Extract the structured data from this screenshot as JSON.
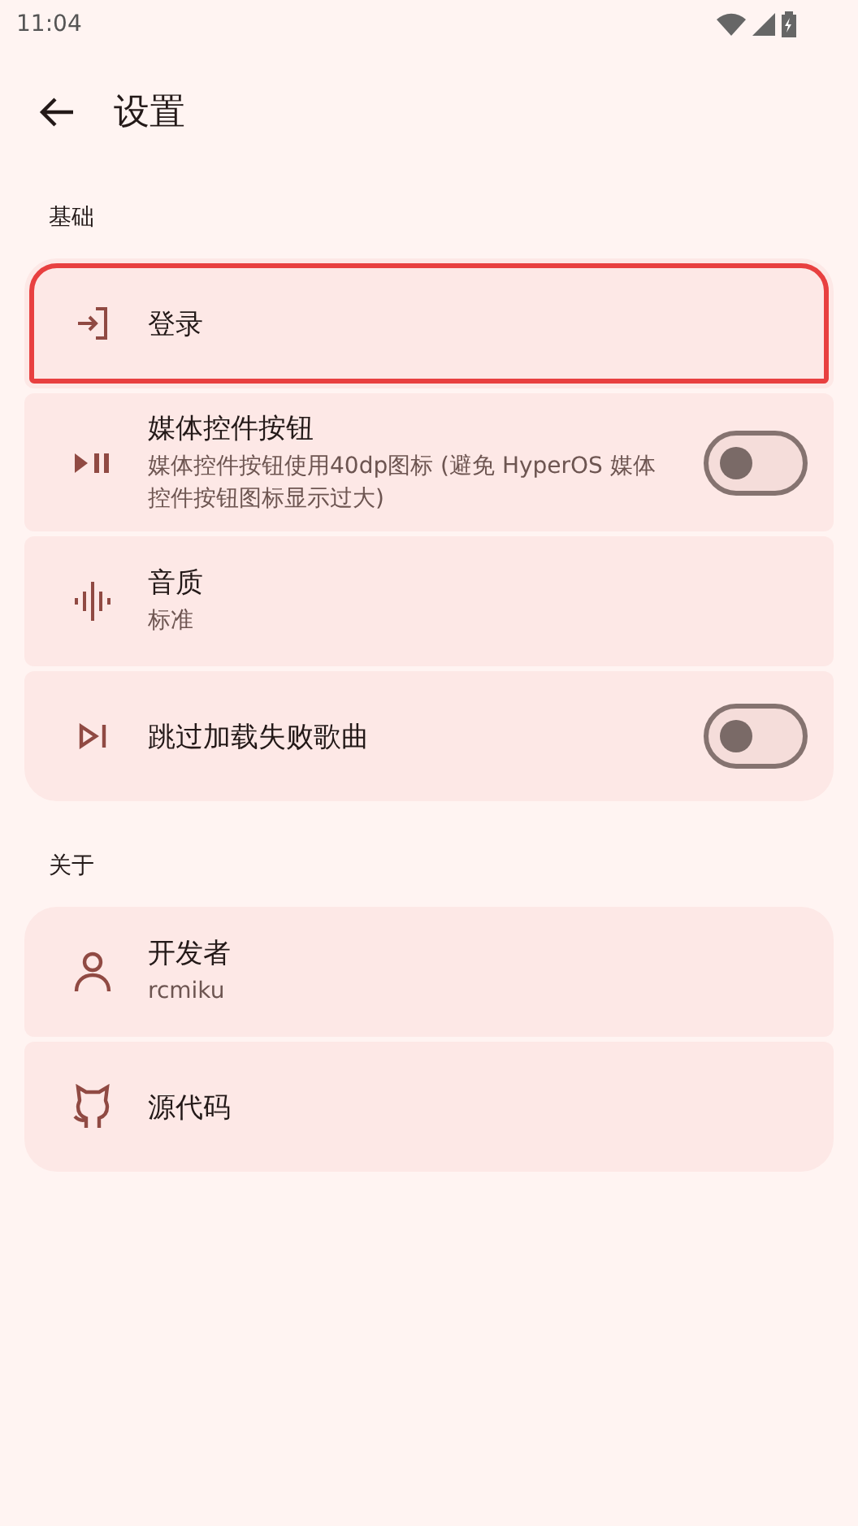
{
  "status_bar": {
    "time": "11:04"
  },
  "header": {
    "title": "设置"
  },
  "sections": [
    {
      "title": "基础",
      "items": [
        {
          "kind": "link",
          "title": "登录",
          "highlighted": true
        },
        {
          "kind": "switch",
          "title": "媒体控件按钮",
          "subtitle": "媒体控件按钮使用40dp图标 (避免 HyperOS 媒体控件按钮图标显示过大)",
          "on": false,
          "highlighted": false
        },
        {
          "kind": "link",
          "title": "音质",
          "subtitle": "标准",
          "highlighted": false
        },
        {
          "kind": "switch",
          "title": "跳过加载失败歌曲",
          "on": false,
          "highlighted": false
        }
      ]
    },
    {
      "title": "关于",
      "items": [
        {
          "kind": "link",
          "title": "开发者",
          "subtitle": "rcmiku",
          "highlighted": false
        },
        {
          "kind": "link",
          "title": "源代码",
          "highlighted": false
        }
      ]
    }
  ]
}
